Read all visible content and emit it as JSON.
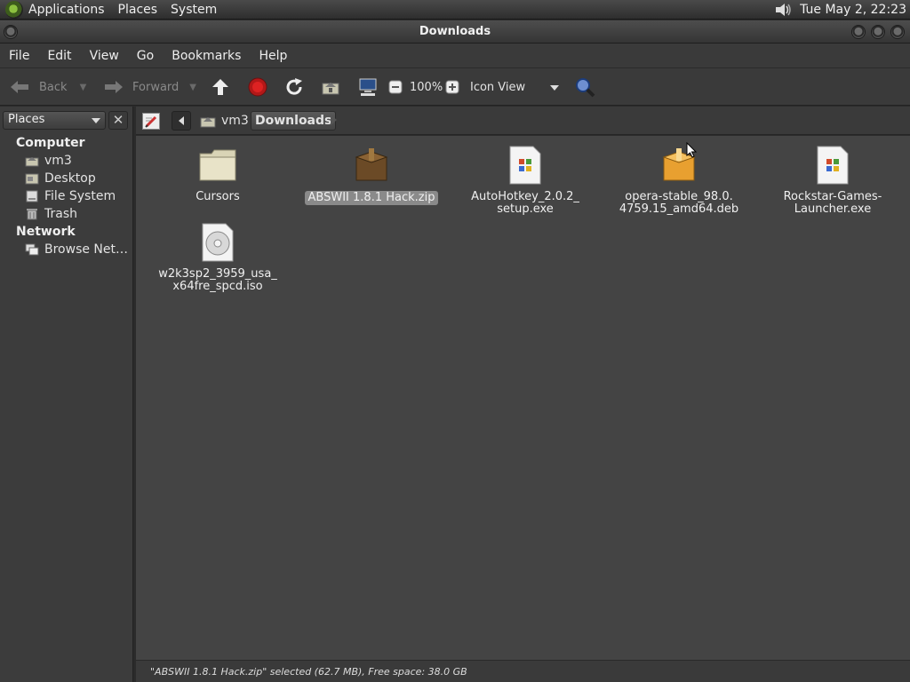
{
  "top_panel": {
    "menus": [
      "Applications",
      "Places",
      "System"
    ],
    "clock": "Tue May  2, 22:23"
  },
  "window": {
    "title": "Downloads"
  },
  "menubar": {
    "items": [
      "File",
      "Edit",
      "View",
      "Go",
      "Bookmarks",
      "Help"
    ]
  },
  "toolbar": {
    "back_label": "Back",
    "forward_label": "Forward",
    "zoom_level": "100%",
    "view_mode": "Icon View"
  },
  "sidebar": {
    "selector_label": "Places",
    "sections": [
      {
        "title": "Computer",
        "items": [
          {
            "label": "vm3",
            "icon": "home-folder-icon"
          },
          {
            "label": "Desktop",
            "icon": "desktop-icon"
          },
          {
            "label": "File System",
            "icon": "drive-icon"
          },
          {
            "label": "Trash",
            "icon": "trash-icon"
          }
        ]
      },
      {
        "title": "Network",
        "items": [
          {
            "label": "Browse Net…",
            "icon": "network-icon"
          }
        ]
      }
    ]
  },
  "location": {
    "crumbs": [
      "vm3",
      "Downloads"
    ]
  },
  "files": [
    {
      "name": "Cursors",
      "type": "folder"
    },
    {
      "name": "ABSWII 1.8.1 Hack.zip",
      "type": "archive",
      "selected": true
    },
    {
      "name": "AutoHotkey_2.0.2_\nsetup.exe",
      "type": "executable"
    },
    {
      "name": "opera-stable_98.0.\n4759.15_amd64.deb",
      "type": "package"
    },
    {
      "name": "Rockstar-Games-\nLauncher.exe",
      "type": "executable"
    },
    {
      "name": "w2k3sp2_3959_usa_\nx64fre_spcd.iso",
      "type": "disc-image"
    }
  ],
  "status": {
    "text": "\"ABSWII 1.8.1 Hack.zip\" selected (62.7 MB), Free space: 38.0 GB"
  },
  "colors": {
    "background": "#444444",
    "panel": "#3a3a3a",
    "selection": "#8a8a8a",
    "folder": "#e8e3c8",
    "package": "#e8a030"
  }
}
